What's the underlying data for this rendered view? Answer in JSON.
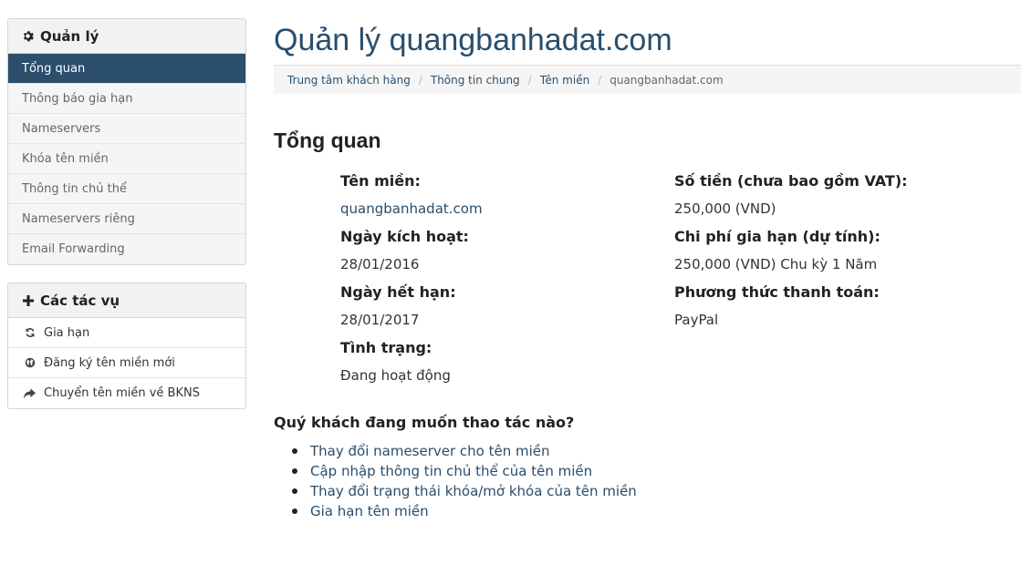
{
  "sidebar": {
    "manage": {
      "title": "Quản lý",
      "items": [
        {
          "label": "Tổng quan",
          "active": true
        },
        {
          "label": "Thông báo gia hạn"
        },
        {
          "label": "Nameservers"
        },
        {
          "label": "Khóa tên miền"
        },
        {
          "label": "Thông tin chủ thể"
        },
        {
          "label": "Nameservers riêng"
        },
        {
          "label": "Email Forwarding"
        }
      ]
    },
    "actions": {
      "title": "Các tác vụ",
      "items": [
        {
          "label": "Gia hạn",
          "icon": "refresh-icon"
        },
        {
          "label": "Đăng ký tên miền mới",
          "icon": "globe-icon"
        },
        {
          "label": "Chuyển tên miền về BKNS",
          "icon": "share-arrow-icon"
        }
      ]
    }
  },
  "main": {
    "title": "Quản lý quangbanhadat.com",
    "breadcrumb": [
      "Trung tâm khách hàng",
      "Thông tin chung",
      "Tên miền",
      "quangbanhadat.com"
    ],
    "section_title": "Tổng quan",
    "fields": {
      "domain_label": "Tên miền:",
      "domain_value": "quangbanhadat.com",
      "activation_label": "Ngày kích hoạt:",
      "activation_value": "28/01/2016",
      "expiry_label": "Ngày hết hạn:",
      "expiry_value": "28/01/2017",
      "status_label": "Tình trạng:",
      "status_value": "Đang hoạt động",
      "amount_label": "Số tiền (chưa bao gồm VAT):",
      "amount_value": "250,000 (VND)",
      "renew_cost_label": "Chi phí gia hạn (dự tính):",
      "renew_cost_value": "250,000 (VND) Chu kỳ 1 Năm",
      "payment_label": "Phương thức thanh toán:",
      "payment_value": "PayPal"
    },
    "question": "Quý khách đang muốn thao tác nào?",
    "action_links": [
      "Thay đổi nameserver cho tên miền",
      "Cập nhập thông tin chủ thể của tên miền",
      "Thay đổi trạng thái khóa/mở khóa của tên miền",
      "Gia hạn tên miền"
    ]
  },
  "colors": {
    "accent": "#2a4e6c",
    "sidebar_bg": "#f5f5f5"
  }
}
